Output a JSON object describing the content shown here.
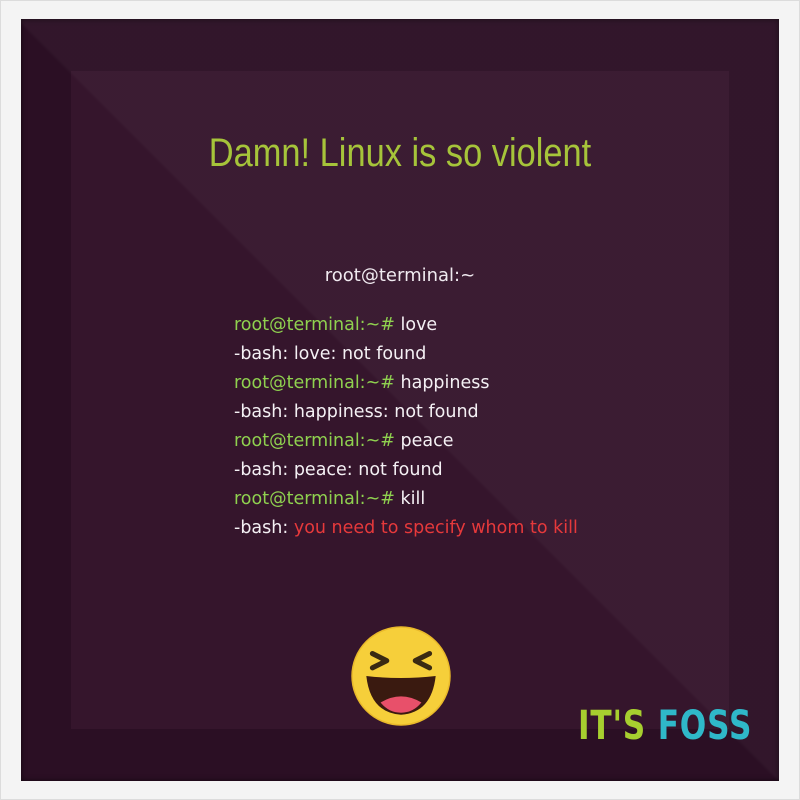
{
  "title": "Damn! Linux is so violent",
  "terminal": {
    "window_title": "root@terminal:~",
    "lines": [
      {
        "prompt": "root@terminal:~#",
        "command": "love"
      },
      {
        "output": "-bash: love: not found"
      },
      {
        "prompt": "root@terminal:~#",
        "command": "happiness"
      },
      {
        "output": "-bash: happiness: not found"
      },
      {
        "prompt": "root@terminal:~#",
        "command": "peace"
      },
      {
        "output": "-bash: peace: not found"
      },
      {
        "prompt": "root@terminal:~#",
        "command": "kill"
      },
      {
        "output": "-bash:",
        "error": "you need to specify whom to kill"
      }
    ]
  },
  "emoji": "laughing-face-icon",
  "logo": {
    "part1": "IT'S",
    "part2": "FOSS"
  },
  "colors": {
    "background": "#2b0f24",
    "title": "#a6c43a",
    "prompt": "#8fd14f",
    "error": "#e6393b",
    "logo_its": "#a7cf2f",
    "logo_foss": "#2fb8c9"
  }
}
